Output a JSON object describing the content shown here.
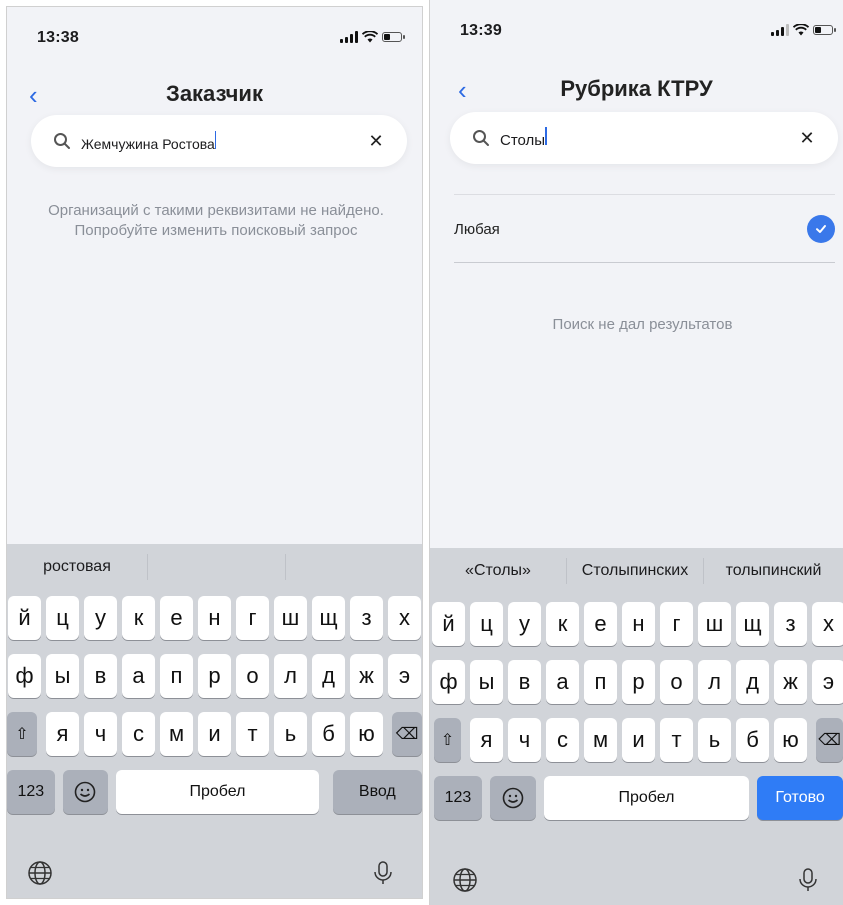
{
  "left": {
    "status": {
      "time": "13:38"
    },
    "nav": {
      "back": "‹",
      "title": "Заказчик"
    },
    "search": {
      "value": "Жемчужина Ростова",
      "clear": "✕"
    },
    "message": "Организаций с такими реквизитами не найдено. Попробуйте изменить поисковый запрос",
    "suggestions": [
      "ростовая",
      "",
      ""
    ],
    "keys": {
      "row1": [
        "й",
        "ц",
        "у",
        "к",
        "е",
        "н",
        "г",
        "ш",
        "щ",
        "з",
        "х"
      ],
      "row2": [
        "ф",
        "ы",
        "в",
        "а",
        "п",
        "р",
        "о",
        "л",
        "д",
        "ж",
        "э"
      ],
      "row3": [
        "я",
        "ч",
        "с",
        "м",
        "и",
        "т",
        "ь",
        "б",
        "ю"
      ],
      "num": "123",
      "space": "Пробел",
      "return": "Ввод"
    }
  },
  "right": {
    "status": {
      "time": "13:39"
    },
    "nav": {
      "back": "‹",
      "title": "Рубрика КТРУ"
    },
    "search": {
      "value": "Столы",
      "clear": "✕"
    },
    "option": {
      "label": "Любая",
      "checked": true
    },
    "message": "Поиск не дал результатов",
    "suggestions": [
      "«Столы»",
      "Столыпинских",
      "толыпинский"
    ],
    "keys": {
      "row1": [
        "й",
        "ц",
        "у",
        "к",
        "е",
        "н",
        "г",
        "ш",
        "щ",
        "з",
        "х"
      ],
      "row2": [
        "ф",
        "ы",
        "в",
        "а",
        "п",
        "р",
        "о",
        "л",
        "д",
        "ж",
        "э"
      ],
      "row3": [
        "я",
        "ч",
        "с",
        "м",
        "и",
        "т",
        "ь",
        "б",
        "ю"
      ],
      "num": "123",
      "space": "Пробел",
      "return": "Готово"
    }
  },
  "colors": {
    "accent": "#2d6ae3",
    "done_button": "#2f7cf6",
    "keyboard_bg": "#d1d4d9",
    "screen_bg": "#f2f3f7"
  }
}
